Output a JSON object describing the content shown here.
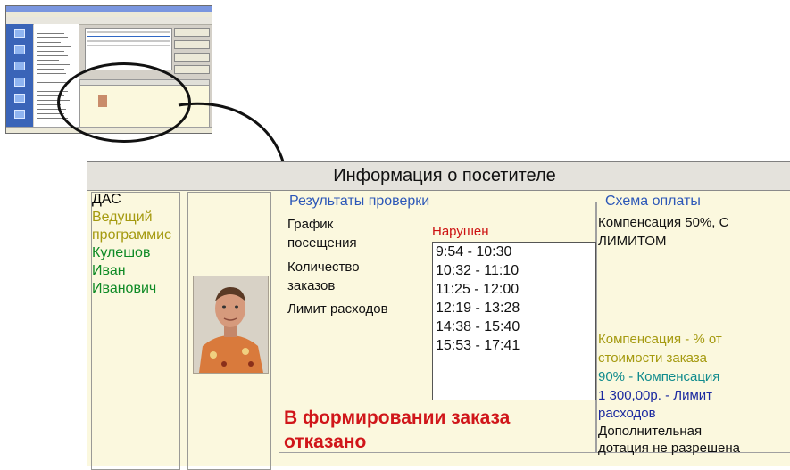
{
  "visitor_panel": {
    "title": "Информация о посетителе",
    "name_lines": [
      {
        "text": "ДАС",
        "color": "#111111"
      },
      {
        "text": "Ведущий",
        "color": "#a59a10"
      },
      {
        "text": "программис",
        "color": "#a59a10"
      },
      {
        "text": "Кулешов",
        "color": "#0e8a25"
      },
      {
        "text": "Иван",
        "color": "#0e8a25"
      },
      {
        "text": "Иванович",
        "color": "#0e8a25"
      }
    ],
    "check_results": {
      "legend": "Результаты проверки",
      "schedule_label_1": "График",
      "schedule_label_2": "посещения",
      "schedule_status": "Нарушен",
      "orders_label_1": "Количество",
      "orders_label_2": "заказов",
      "limit_label": "Лимит расходов",
      "time_intervals": [
        "9:54 - 10:30",
        "10:32 - 11:10",
        "11:25 - 12:00",
        "12:19 - 13:28",
        "14:38 - 15:40",
        "15:53 - 17:41"
      ],
      "refusal_1": "В формировании заказа",
      "refusal_2": "отказано"
    },
    "payment_scheme": {
      "legend": "Схема оплаты",
      "comp_1": "Компенсация 50%, С",
      "comp_2": "ЛИМИТОМ",
      "pct_1": "Компенсация - % от",
      "pct_2": "стоимости заказа",
      "value_pct": "90% - Компенсация",
      "value_limit": "1 300,00р. - Лимит",
      "value_limit_2": "расходов",
      "extra_1": "Дополнительная",
      "extra_2": "дотация не разрешена"
    }
  },
  "colors": {
    "violation": "#cc1111",
    "legend": "#2d58b8",
    "refusal": "#d0161a"
  }
}
